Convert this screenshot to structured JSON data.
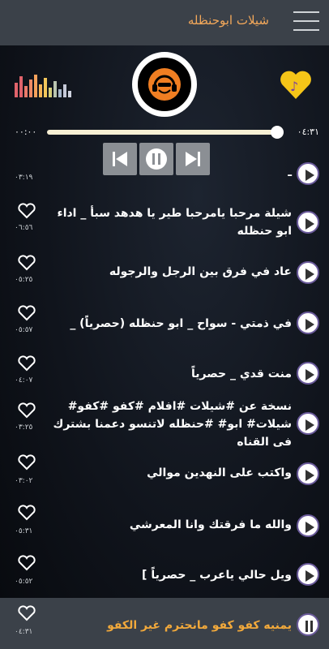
{
  "app": {
    "title": "شيلات ابوحنظله"
  },
  "player": {
    "elapsed": "٠٠:٠٠",
    "duration": "٠٤:٣١",
    "progress": 0.98,
    "state": "playing"
  },
  "tracks": [
    {
      "title": "ـ",
      "duration": "٠٣:١٩"
    },
    {
      "title": "شيلة مرحبا يامرحبا طير يا هدهد سبأ _ اداء ابو حنظله",
      "duration": "٠٦:٥٦"
    },
    {
      "title": "عاد في فرق بين الرجل والرجوله",
      "duration": "٠٥:٢٥"
    },
    {
      "title": "في ذمتي - سواح _ ابو حنظله (حصرياً) _",
      "duration": "٠٥:٥٧"
    },
    {
      "title": "منت قدي _ حصرياً",
      "duration": "٠٤:٠٧"
    },
    {
      "title": "نسخة عن #شيلات #افلام #كفو #كفو# شيلات# ابو# #حنظله لاتنسو دعمنا بشترك فى القناه",
      "duration": "٠٣:٢٥"
    },
    {
      "title": "واكتب على النهدين موالي",
      "duration": "٠٣:٠٢"
    },
    {
      "title": "والله ما فرقتك وانا المعرشي",
      "duration": "٠٥:٣١"
    },
    {
      "title": "ويل حالي ياعرب _ حصرياً ]",
      "duration": "٠٥:٥٢"
    },
    {
      "title": "يمنيه كفو كفو مانحترم غير الكفو",
      "duration": "٠٤:٣١"
    }
  ],
  "colors": {
    "accent": "#f3a85a",
    "topbar": "#3b4149",
    "now_playing": "#f2a93b"
  }
}
